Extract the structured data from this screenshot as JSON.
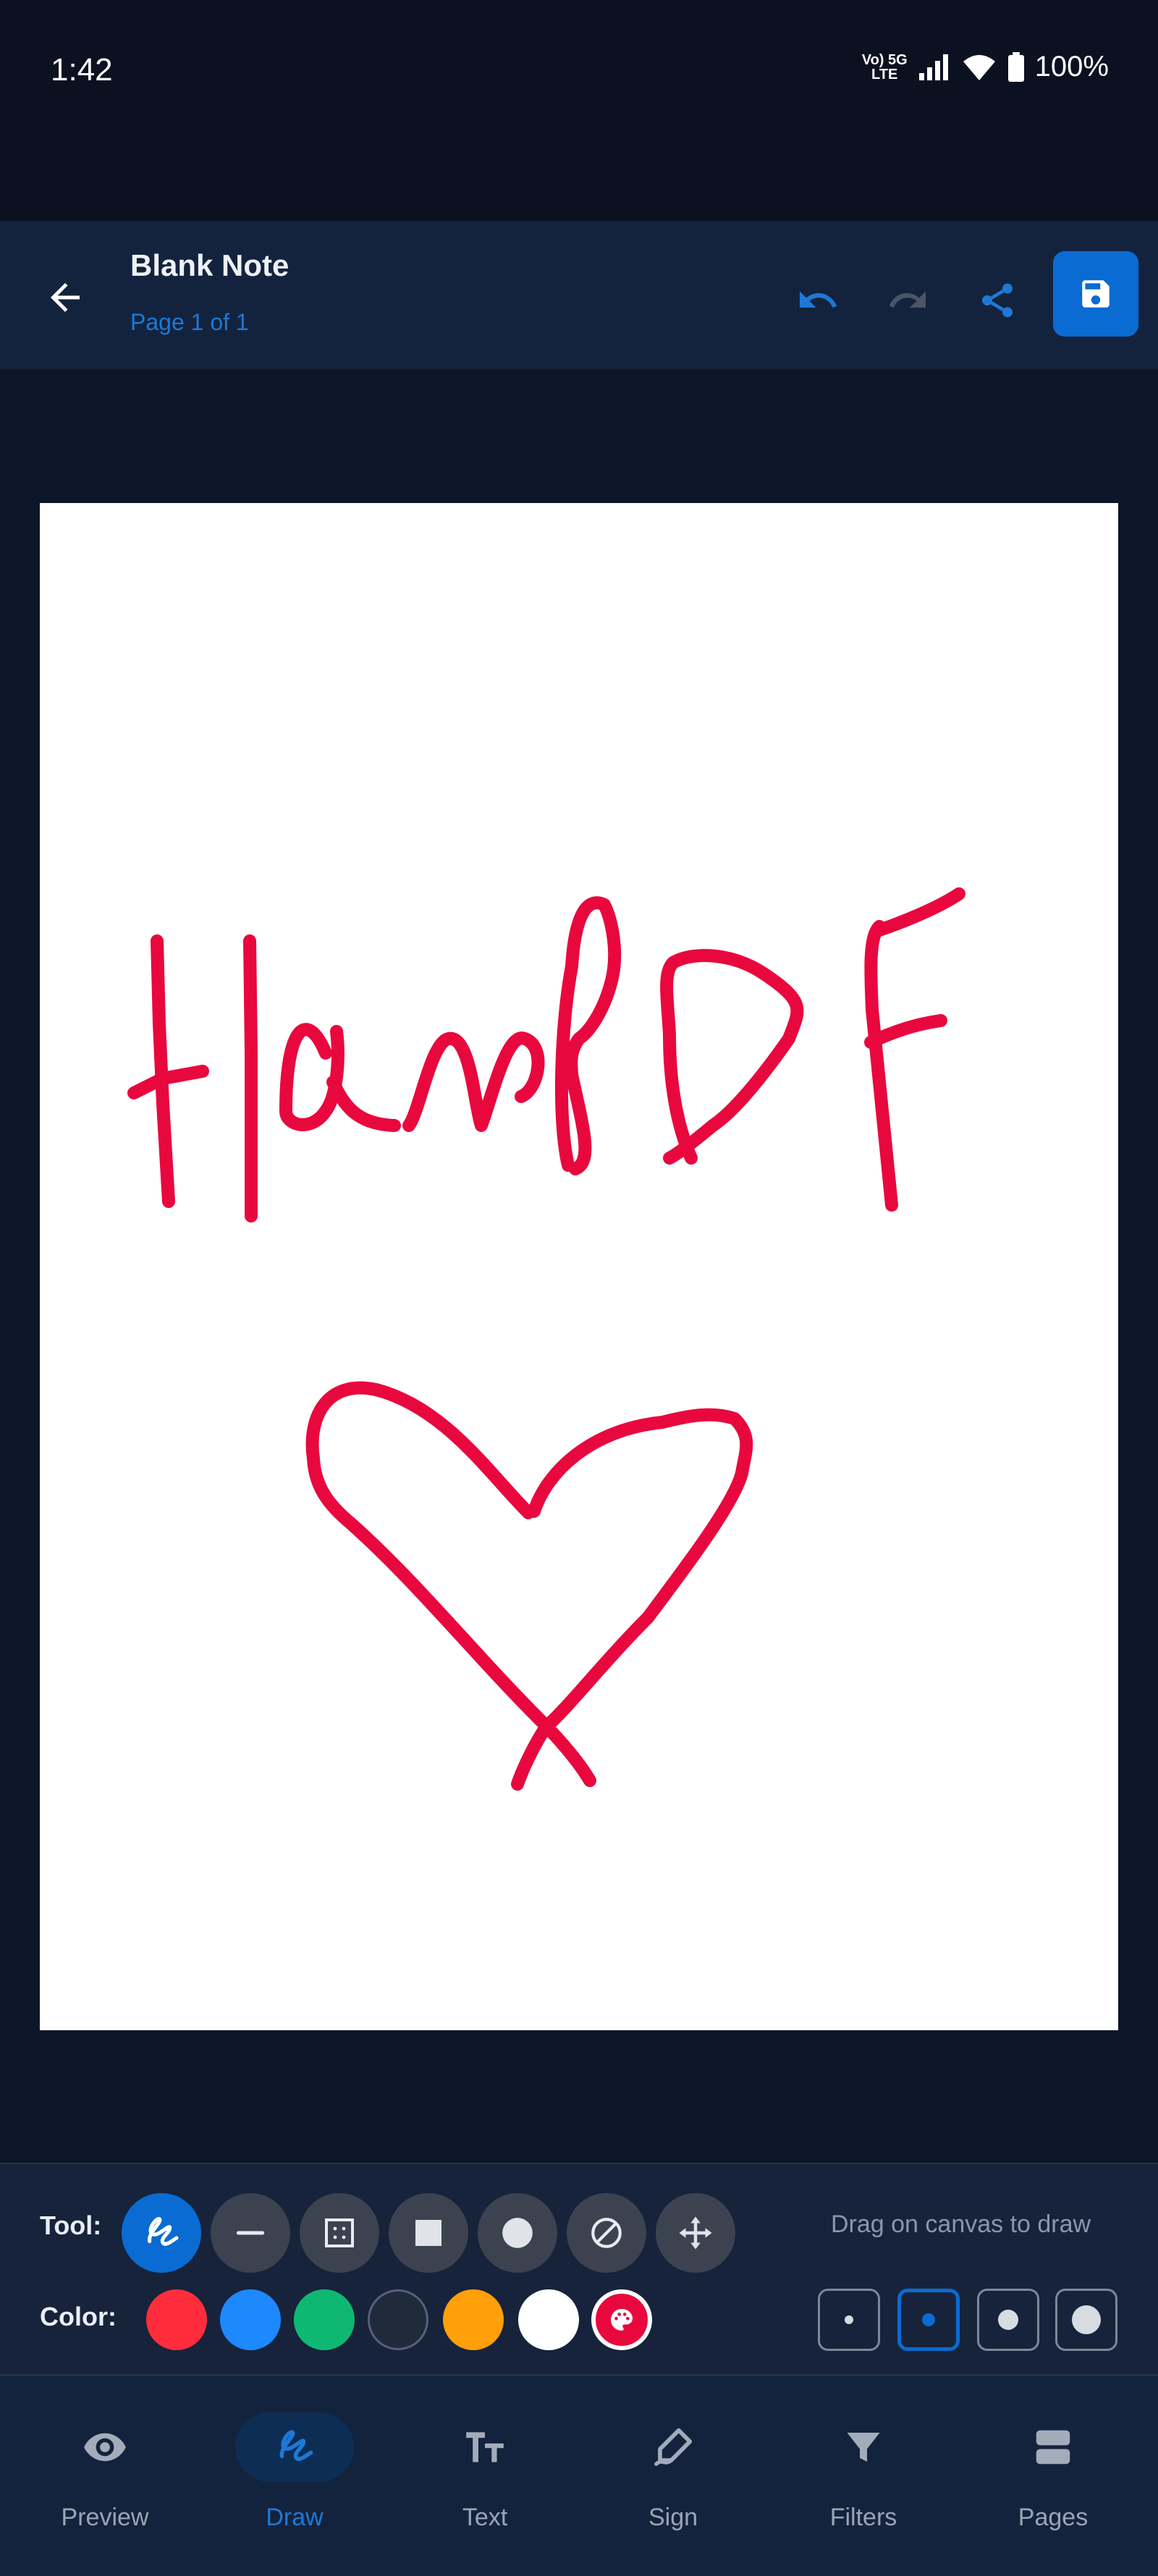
{
  "status_bar": {
    "time": "1:42",
    "network_top": "Vo) 5G",
    "network_bottom": "LTE",
    "battery": "100%"
  },
  "header": {
    "title": "Blank Note",
    "subtitle": "Page 1 of 1"
  },
  "tools": {
    "label": "Tool:",
    "hint": "Drag on canvas to draw",
    "items": [
      {
        "icon": "freehand-icon",
        "active": true
      },
      {
        "icon": "line-icon"
      },
      {
        "icon": "select-icon"
      },
      {
        "icon": "rectangle-icon"
      },
      {
        "icon": "circle-icon"
      },
      {
        "icon": "eraser-icon"
      },
      {
        "icon": "move-icon"
      }
    ]
  },
  "colors": {
    "label": "Color:",
    "swatches": [
      "#ff2d3c",
      "#1e88ff",
      "#0fb872",
      "#1f2a3a",
      "#ff9f0a",
      "#ffffff"
    ],
    "custom_selected": "#e8083e",
    "stroke_color": "#e8083e"
  },
  "sizes": {
    "options": [
      "small",
      "medium",
      "large",
      "x-large"
    ],
    "selected": "medium"
  },
  "nav": [
    {
      "label": "Preview",
      "icon": "eye-icon"
    },
    {
      "label": "Draw",
      "icon": "draw-icon",
      "active": true
    },
    {
      "label": "Text",
      "icon": "text-icon"
    },
    {
      "label": "Sign",
      "icon": "sign-icon"
    },
    {
      "label": "Filters",
      "icon": "filter-icon"
    },
    {
      "label": "Pages",
      "icon": "pages-icon"
    }
  ]
}
